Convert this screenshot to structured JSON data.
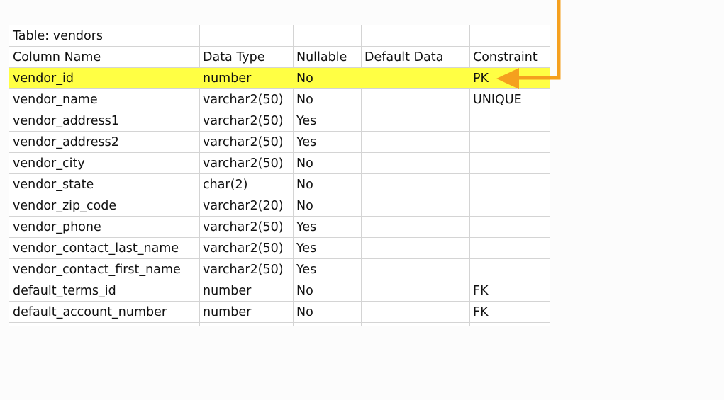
{
  "table": {
    "title": "Table: vendors",
    "headers": [
      "Column Name",
      "Data Type",
      "Nullable",
      "Default Data",
      "Constraint"
    ],
    "rows": [
      [
        "vendor_id",
        "number",
        "No",
        "",
        "PK"
      ],
      [
        "vendor_name",
        "varchar2(50)",
        "No",
        "",
        "UNIQUE"
      ],
      [
        "vendor_address1",
        "varchar2(50)",
        "Yes",
        "",
        ""
      ],
      [
        "vendor_address2",
        "varchar2(50)",
        "Yes",
        "",
        ""
      ],
      [
        "vendor_city",
        "varchar2(50)",
        "No",
        "",
        ""
      ],
      [
        "vendor_state",
        "char(2)",
        "No",
        "",
        ""
      ],
      [
        "vendor_zip_code",
        "varchar2(20)",
        "No",
        "",
        ""
      ],
      [
        "vendor_phone",
        "varchar2(50)",
        "Yes",
        "",
        ""
      ],
      [
        "vendor_contact_last_name",
        "varchar2(50)",
        "Yes",
        "",
        ""
      ],
      [
        "vendor_contact_first_name",
        "varchar2(50)",
        "Yes",
        "",
        ""
      ],
      [
        "default_terms_id",
        "number",
        "No",
        "",
        "FK"
      ],
      [
        "default_account_number",
        "number",
        "No",
        "",
        "FK"
      ]
    ]
  },
  "colors": {
    "highlight": "#ffff44",
    "arrow": "#f5a01e"
  },
  "annotation": {
    "icon": "arrow-icon"
  }
}
